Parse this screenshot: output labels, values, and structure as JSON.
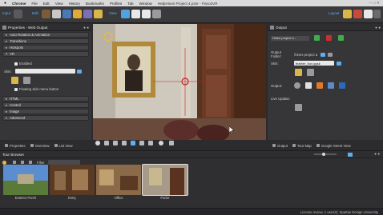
{
  "mac_menu": {
    "apple": "",
    "items": [
      "Chrome",
      "File",
      "Edit",
      "View",
      "History",
      "Bookmarks",
      "Profiles",
      "Tab",
      "Window",
      "Help"
    ],
    "window_title": "Hines Project 4.p4vr - Pano2VR"
  },
  "toolbar": {
    "input_label": "Input",
    "edit_label": "Edit",
    "view_label": "View",
    "layout_label": "Layout"
  },
  "left_panel": {
    "title": "Properties - Web Output",
    "sections": [
      "Auto Rotation & Animation",
      "Transitions",
      "Hotspots",
      "VR"
    ],
    "vr": {
      "enabled_label": "Enabled",
      "skin_label": "Skin:",
      "floating_label": "Floating skin menu button"
    },
    "bottom_sections": [
      "HTML",
      "Control",
      "Image",
      "Advanced"
    ]
  },
  "right_panel": {
    "title": "Output",
    "format_value": "Hines project a...",
    "output_folder_label": "Output Folder:",
    "output_folder_value": "/hines project a",
    "skin_label": "Skin:",
    "skin_value": "feather_box.ggsk",
    "output_label": "Output:",
    "live_update_label": "Live Update:"
  },
  "bottom_tabs_left": [
    "Properties",
    "Overview",
    "List View"
  ],
  "bottom_tabs_right": [
    "Output",
    "Tour Map",
    "Google Street View"
  ],
  "tour_browser": {
    "title": "Tour Browser",
    "filter_label": "Filter",
    "nodes": [
      {
        "label": "Exterior Porch",
        "color": "#4a78b8"
      },
      {
        "label": "Entry",
        "color": "#7a5a3a"
      },
      {
        "label": "Office",
        "color": "#8a6a48"
      },
      {
        "label": "Parlor",
        "color": "#9a8a7a"
      }
    ]
  },
  "status_bar": {
    "text": "License review, 1 user(s): Spartan Design University"
  },
  "colors": {
    "accent_blue": "#5eaef0",
    "panel_bg": "#363638",
    "header_bg": "#2e2e30"
  }
}
